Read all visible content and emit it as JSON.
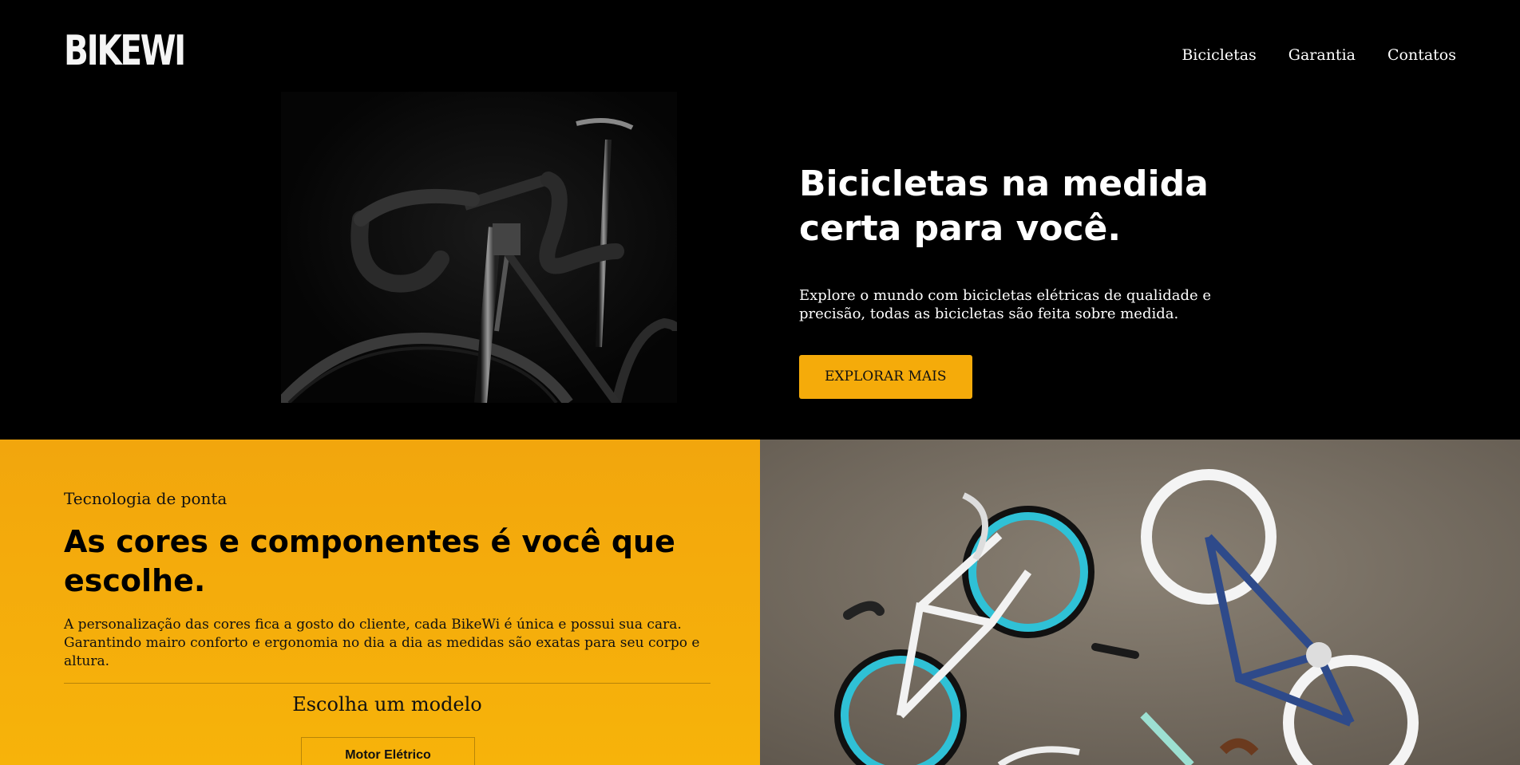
{
  "brand": {
    "logo": "BIKEWI"
  },
  "nav": {
    "items": [
      {
        "label": "Bicicletas"
      },
      {
        "label": "Garantia"
      },
      {
        "label": "Contatos"
      }
    ]
  },
  "hero": {
    "title_line1": "Bicicletas na medida",
    "title_line2": "certa para você.",
    "description": "Explore o mundo com bicicletas elétricas de qualidade e precisão, todas as bicicletas são feita sobre medida.",
    "cta_label": "EXPLORAR MAIS"
  },
  "feature": {
    "eyebrow": "Tecnologia de ponta",
    "title": "As cores e componentes é você que escolhe.",
    "description": "A personalização das cores fica a gosto do cliente, cada BikeWi é única e possui sua cara. Garantindo mairo conforto e ergonomia no dia a dia as medidas são exatas para seu corpo e altura.",
    "model_heading": "Escolha um modelo",
    "model_option": "Motor Elétrico"
  },
  "colors": {
    "background": "#000000",
    "accent": "#f5ab0a",
    "text_light": "#ffffff",
    "text_dark": "#111111"
  },
  "icons": [
    "bike-photo-dark",
    "bikes-on-sand-photo"
  ]
}
